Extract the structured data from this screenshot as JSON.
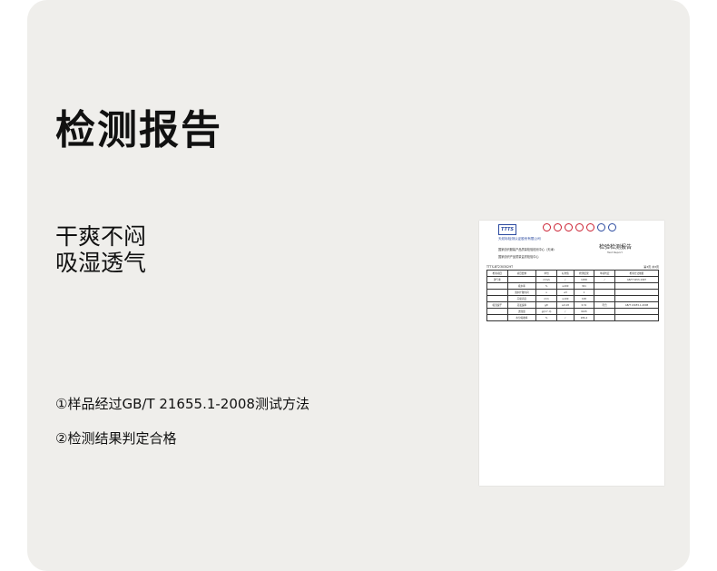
{
  "title": "检测报告",
  "features": [
    "干爽不闷",
    "吸湿透气"
  ],
  "notes": [
    "①样品经过GB/T 21655.1-2008测试方法",
    "②检测结果判定合格"
  ],
  "report": {
    "logo_text": "TTTS",
    "org_name": "天纺标检测认证股份有限公司",
    "center_name": "国家纺织服装产品质量检验检测中心（天津）",
    "center_name2": "国家纺织产品质量监督检验中心",
    "title": "检验检测报告",
    "title_en": "Test Report",
    "report_no": "TTTS-BT2303029T",
    "page": "第3页 共3页",
    "table_header": [
      "检验项目",
      "项目要求",
      "单位",
      "标准值",
      "检测结果",
      "单项判定",
      "检验方法依据"
    ],
    "rows": [
      [
        "透气率",
        "",
        "mm/s",
        "/",
        "1058",
        "/",
        "GB/T 5453-1997"
      ],
      [
        "",
        "吸水率",
        "%",
        "≥200",
        "301",
        "",
        ""
      ],
      [
        "",
        "滴水扩散时间",
        "s",
        "≤3",
        "1",
        "",
        ""
      ],
      [
        "",
        "芯吸高度",
        "mm",
        "≥100",
        "108",
        "",
        ""
      ],
      [
        "吸湿速干",
        "蒸发速率",
        "g/h",
        "≥0.18",
        "0.31",
        "符合",
        "GB/T 21655.1-2008"
      ],
      [
        "",
        "透湿量",
        "g/(m²·d)",
        "/",
        "9245",
        "",
        ""
      ],
      [
        "",
        "水分吸收率",
        "%",
        "/",
        "286.4",
        "",
        ""
      ]
    ]
  }
}
